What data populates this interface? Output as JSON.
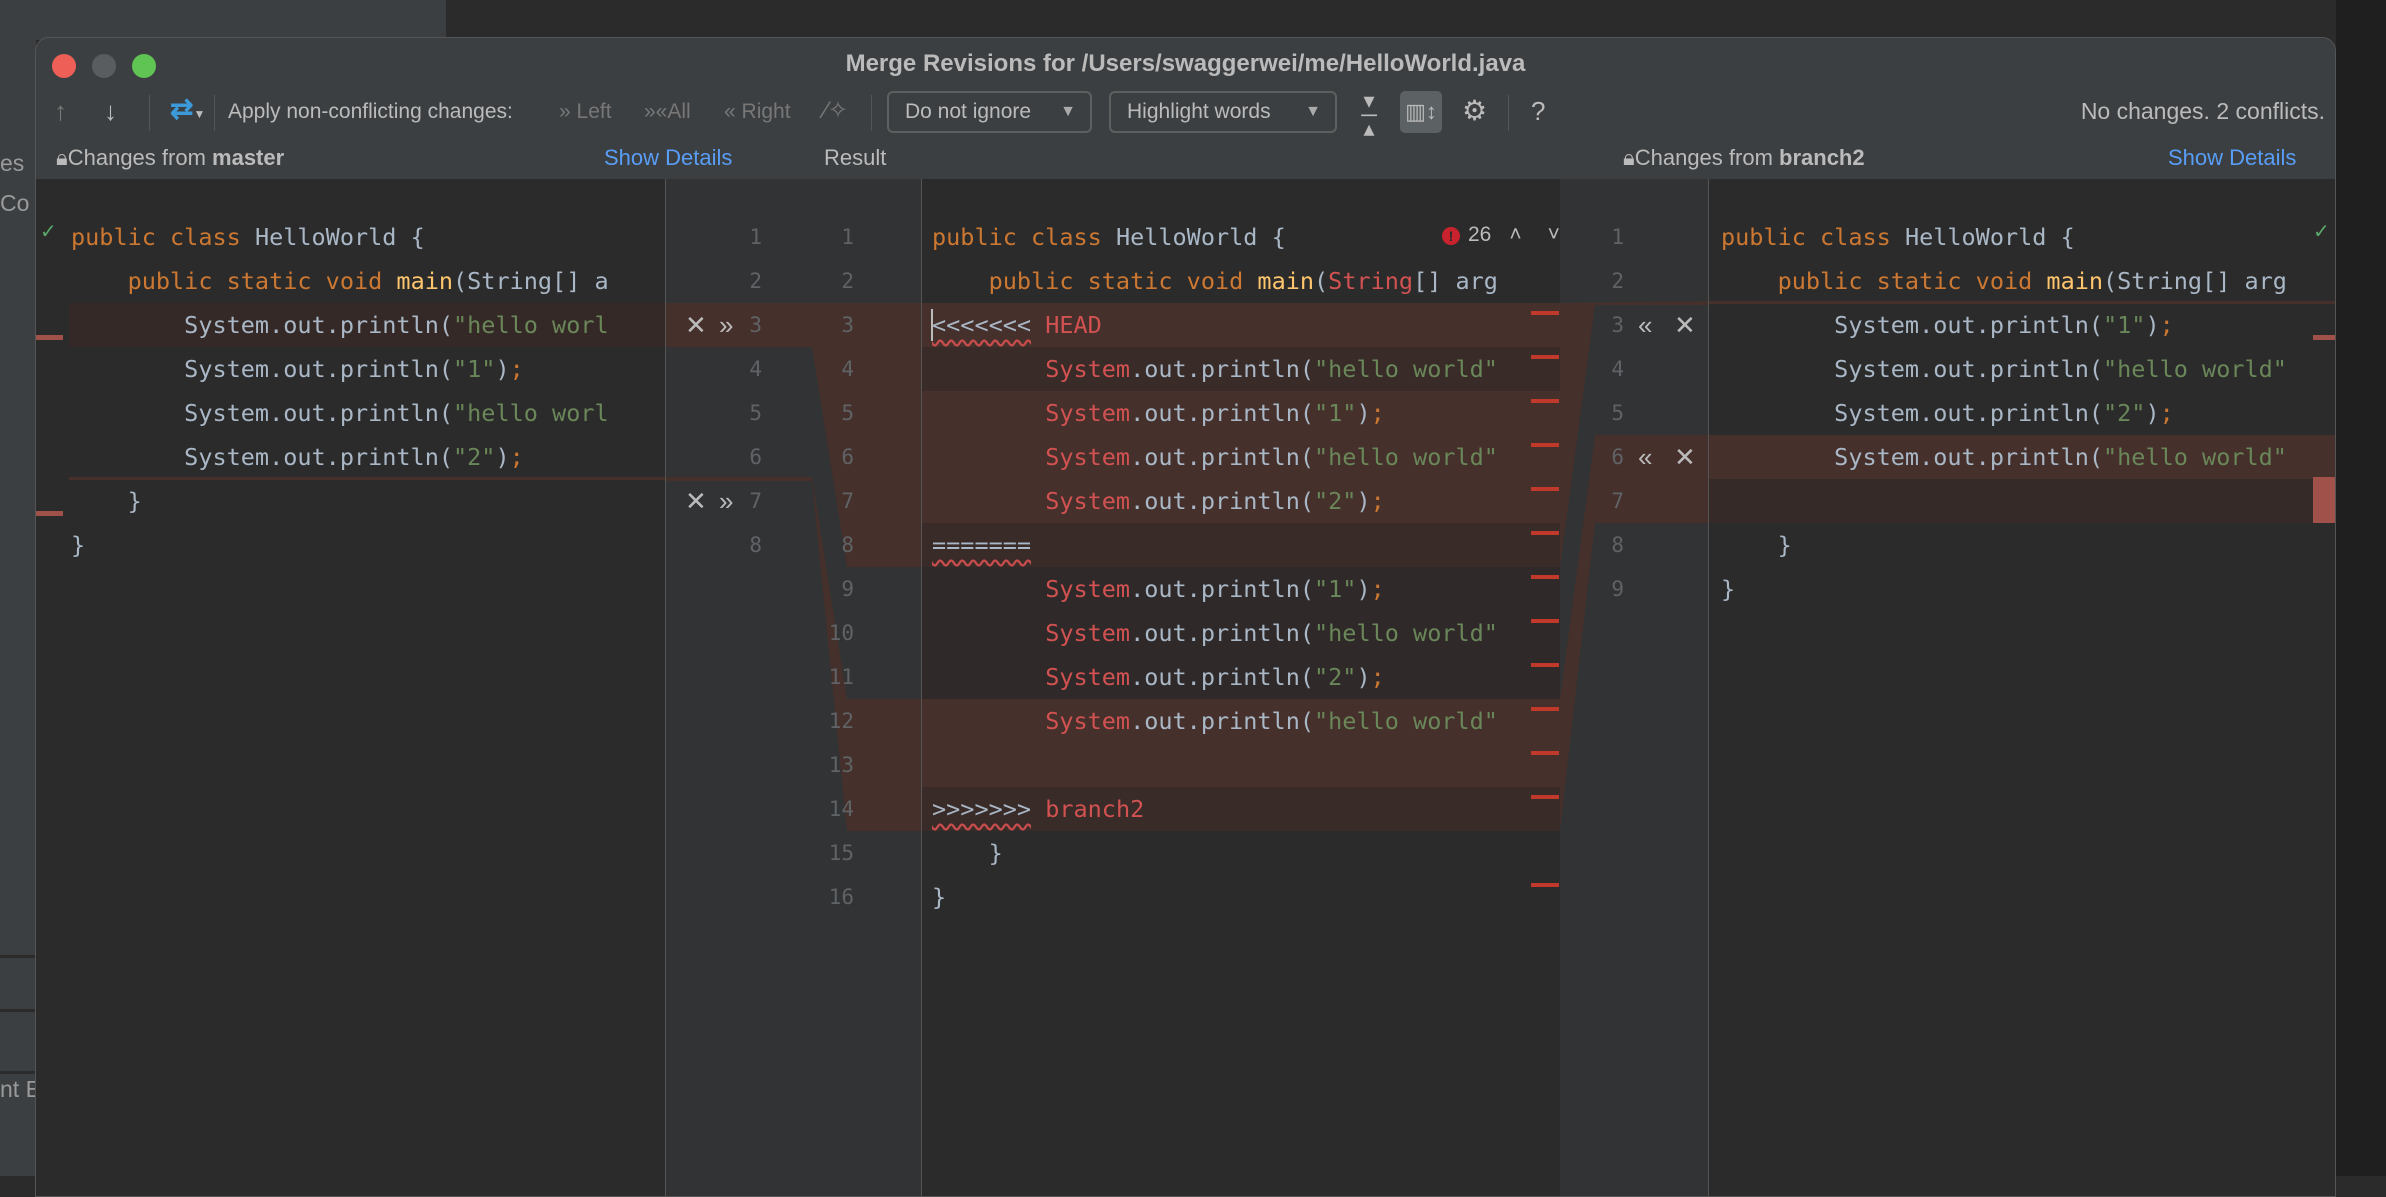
{
  "background": {
    "texts": [
      "es",
      "Co",
      "nt E"
    ]
  },
  "window": {
    "title": "Merge Revisions for /Users/swaggerwei/me/HelloWorld.java",
    "traffic_lights": {
      "close": "#ee5f57",
      "minimize": "#5a5d60",
      "maximize": "#5fc454"
    }
  },
  "toolbar": {
    "prev_icon": "arrow-up-icon",
    "next_icon": "arrow-down-icon",
    "apply_label": "Apply non-conflicting changes:",
    "left_label": "Left",
    "all_label": "All",
    "right_label": "Right",
    "ignore_dropdown": "Do not ignore",
    "highlight_dropdown": "Highlight words",
    "help_label": "?",
    "status": "No changes. 2 conflicts."
  },
  "colors": {
    "accent_link": "#589df6",
    "conflict": "#45302b",
    "keyword": "#cc7832",
    "string": "#6a8759",
    "error": "#d25252"
  },
  "panes": {
    "left": {
      "header_prefix": "Changes from ",
      "header_branch": "master",
      "show_details": "Show Details",
      "line_numbers": [
        "1",
        "2",
        "3",
        "4",
        "5",
        "6",
        "7",
        "8"
      ],
      "lines": [
        [
          [
            "public class ",
            "k"
          ],
          [
            "HelloWorld {",
            "p"
          ]
        ],
        [
          [
            "    public static void ",
            "k"
          ],
          [
            "main",
            "f"
          ],
          [
            "(String[] a",
            "p"
          ]
        ],
        [
          [
            "        System.out.println(",
            "p"
          ],
          [
            "\"hello worl",
            "s"
          ]
        ],
        [
          [
            "        System.out.println(",
            "p"
          ],
          [
            "\"1\"",
            "s"
          ],
          [
            ")",
            "p"
          ],
          [
            ";",
            "k"
          ]
        ],
        [
          [
            "        System.out.println(",
            "p"
          ],
          [
            "\"hello worl",
            "s"
          ]
        ],
        [
          [
            "        System.out.println(",
            "p"
          ],
          [
            "\"2\"",
            "s"
          ],
          [
            ")",
            "p"
          ],
          [
            ";",
            "k"
          ]
        ],
        [
          [
            "    }",
            "p"
          ]
        ],
        [
          [
            "}",
            "p"
          ]
        ]
      ]
    },
    "result": {
      "header": "Result",
      "error_count": "26",
      "line_numbers": [
        "1",
        "2",
        "3",
        "4",
        "5",
        "6",
        "7",
        "8",
        "9",
        "10",
        "11",
        "12",
        "13",
        "14",
        "15",
        "16"
      ],
      "lines": [
        [
          [
            "public class ",
            "k"
          ],
          [
            "HelloWorld {",
            "p"
          ]
        ],
        [
          [
            "    public static void ",
            "k"
          ],
          [
            "main",
            "f"
          ],
          [
            "(",
            "p"
          ],
          [
            "String",
            "e"
          ],
          [
            "[] arg",
            "p"
          ]
        ],
        [
          [
            "<<<<<<<",
            "m"
          ],
          [
            " ",
            "p"
          ],
          [
            "HEAD",
            "e"
          ]
        ],
        [
          [
            "        ",
            "p"
          ],
          [
            "System",
            "e"
          ],
          [
            ".out.println(",
            "p"
          ],
          [
            "\"hello world\"",
            "s"
          ]
        ],
        [
          [
            "        ",
            "p"
          ],
          [
            "System",
            "e"
          ],
          [
            ".out.println(",
            "p"
          ],
          [
            "\"1\"",
            "s"
          ],
          [
            ")",
            "p"
          ],
          [
            ";",
            "k"
          ]
        ],
        [
          [
            "        ",
            "p"
          ],
          [
            "System",
            "e"
          ],
          [
            ".out.println(",
            "p"
          ],
          [
            "\"hello world\"",
            "s"
          ]
        ],
        [
          [
            "        ",
            "p"
          ],
          [
            "System",
            "e"
          ],
          [
            ".out.println(",
            "p"
          ],
          [
            "\"2\"",
            "s"
          ],
          [
            ")",
            "p"
          ],
          [
            ";",
            "k"
          ]
        ],
        [
          [
            "=======",
            "m"
          ]
        ],
        [
          [
            "        ",
            "p"
          ],
          [
            "System",
            "e"
          ],
          [
            ".out.println(",
            "p"
          ],
          [
            "\"1\"",
            "s"
          ],
          [
            ")",
            "p"
          ],
          [
            ";",
            "k"
          ]
        ],
        [
          [
            "        ",
            "p"
          ],
          [
            "System",
            "e"
          ],
          [
            ".out.println(",
            "p"
          ],
          [
            "\"hello world\"",
            "s"
          ]
        ],
        [
          [
            "        ",
            "p"
          ],
          [
            "System",
            "e"
          ],
          [
            ".out.println(",
            "p"
          ],
          [
            "\"2\"",
            "s"
          ],
          [
            ")",
            "p"
          ],
          [
            ";",
            "k"
          ]
        ],
        [
          [
            "        ",
            "p"
          ],
          [
            "System",
            "e"
          ],
          [
            ".out.println(",
            "p"
          ],
          [
            "\"hello world\"",
            "s"
          ]
        ],
        [
          [
            "",
            "p"
          ]
        ],
        [
          [
            ">>>>>>>",
            "m"
          ],
          [
            " ",
            "p"
          ],
          [
            "branch2",
            "e"
          ]
        ],
        [
          [
            "    }",
            "p"
          ]
        ],
        [
          [
            "}",
            "p"
          ]
        ]
      ]
    },
    "right": {
      "header_prefix": "Changes from ",
      "header_branch": "branch2",
      "show_details": "Show Details",
      "line_numbers": [
        "1",
        "2",
        "3",
        "4",
        "5",
        "6",
        "7",
        "8",
        "9"
      ],
      "lines": [
        [
          [
            "public class ",
            "k"
          ],
          [
            "HelloWorld {",
            "p"
          ]
        ],
        [
          [
            "    public static void ",
            "k"
          ],
          [
            "main",
            "f"
          ],
          [
            "(String[] arg",
            "p"
          ]
        ],
        [
          [
            "        System.out.println(",
            "p"
          ],
          [
            "\"1\"",
            "s"
          ],
          [
            ")",
            "p"
          ],
          [
            ";",
            "k"
          ]
        ],
        [
          [
            "        System.out.println(",
            "p"
          ],
          [
            "\"hello world\"",
            "s"
          ]
        ],
        [
          [
            "        System.out.println(",
            "p"
          ],
          [
            "\"2\"",
            "s"
          ],
          [
            ")",
            "p"
          ],
          [
            ";",
            "k"
          ]
        ],
        [
          [
            "        System.out.println(",
            "p"
          ],
          [
            "\"hello world\"",
            "s"
          ]
        ],
        [
          [
            "",
            "p"
          ]
        ],
        [
          [
            "    }",
            "p"
          ]
        ],
        [
          [
            "}",
            "p"
          ]
        ]
      ]
    }
  }
}
